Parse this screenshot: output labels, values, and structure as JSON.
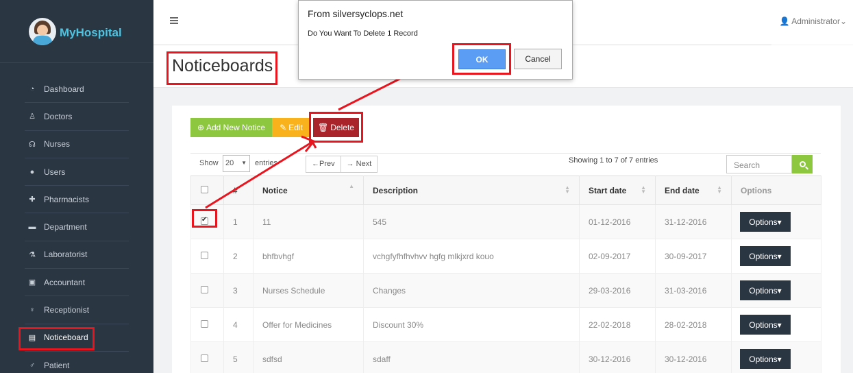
{
  "brand": {
    "name": "MyHospital"
  },
  "sidebar": {
    "items": [
      {
        "label": "Dashboard",
        "icon": "dashboard-icon",
        "glyph": "◔"
      },
      {
        "label": "Doctors",
        "icon": "user-md-icon",
        "glyph": "♙"
      },
      {
        "label": "Nurses",
        "icon": "stethoscope-icon",
        "glyph": "☊"
      },
      {
        "label": "Users",
        "icon": "user-icon",
        "glyph": "●"
      },
      {
        "label": "Pharmacists",
        "icon": "plus-square-icon",
        "glyph": "✚"
      },
      {
        "label": "Department",
        "icon": "briefcase-icon",
        "glyph": "▬"
      },
      {
        "label": "Laboratorist",
        "icon": "flask-icon",
        "glyph": "⚗"
      },
      {
        "label": "Accountant",
        "icon": "money-icon",
        "glyph": "▣"
      },
      {
        "label": "Receptionist",
        "icon": "female-icon",
        "glyph": "♀"
      },
      {
        "label": "Noticeboard",
        "icon": "file-text-icon",
        "glyph": "▤"
      },
      {
        "label": "Patient",
        "icon": "male-icon",
        "glyph": "♂"
      }
    ]
  },
  "header": {
    "user": "Administrator"
  },
  "page": {
    "title": "Noticeboards"
  },
  "toolbar": {
    "add_label": "Add New Notice",
    "edit_label": "Edit",
    "delete_label": "Delete"
  },
  "datatable": {
    "show_label": "Show",
    "page_size": "20",
    "entries_label": "entries",
    "prev_label": "←Prev",
    "next_label": "→ Next",
    "info": "Showing 1 to 7 of 7 entries",
    "search_placeholder": "Search",
    "columns": [
      "",
      "#",
      "Notice",
      "Description",
      "Start date",
      "End date",
      "Options"
    ],
    "rows": [
      {
        "num": "1",
        "notice": "11",
        "description": "545",
        "start": "01-12-2016",
        "end": "31-12-2016",
        "checked": true
      },
      {
        "num": "2",
        "notice": "bhfbvhgf",
        "description": "vchgfyfhfhvhvv hgfg mlkjxrd kouo",
        "start": "02-09-2017",
        "end": "30-09-2017",
        "checked": false
      },
      {
        "num": "3",
        "notice": "Nurses Schedule",
        "description": "Changes",
        "start": "29-03-2016",
        "end": "31-03-2016",
        "checked": false
      },
      {
        "num": "4",
        "notice": "Offer for Medicines",
        "description": "Discount 30%",
        "start": "22-02-2018",
        "end": "28-02-2018",
        "checked": false
      },
      {
        "num": "5",
        "notice": "sdfsd",
        "description": "sdaff",
        "start": "30-12-2016",
        "end": "30-12-2016",
        "checked": false
      }
    ],
    "options_label": "Options"
  },
  "dialog": {
    "title": "From silversyclops.net",
    "message": "Do You Want To Delete 1 Record",
    "ok_label": "OK",
    "cancel_label": "Cancel"
  },
  "colors": {
    "sidebar": "#2b3643",
    "add": "#8dc63f",
    "edit": "#f9b21b",
    "delete": "#a8232a",
    "highlight": "#e8141e",
    "ok": "#5b9cf5"
  }
}
